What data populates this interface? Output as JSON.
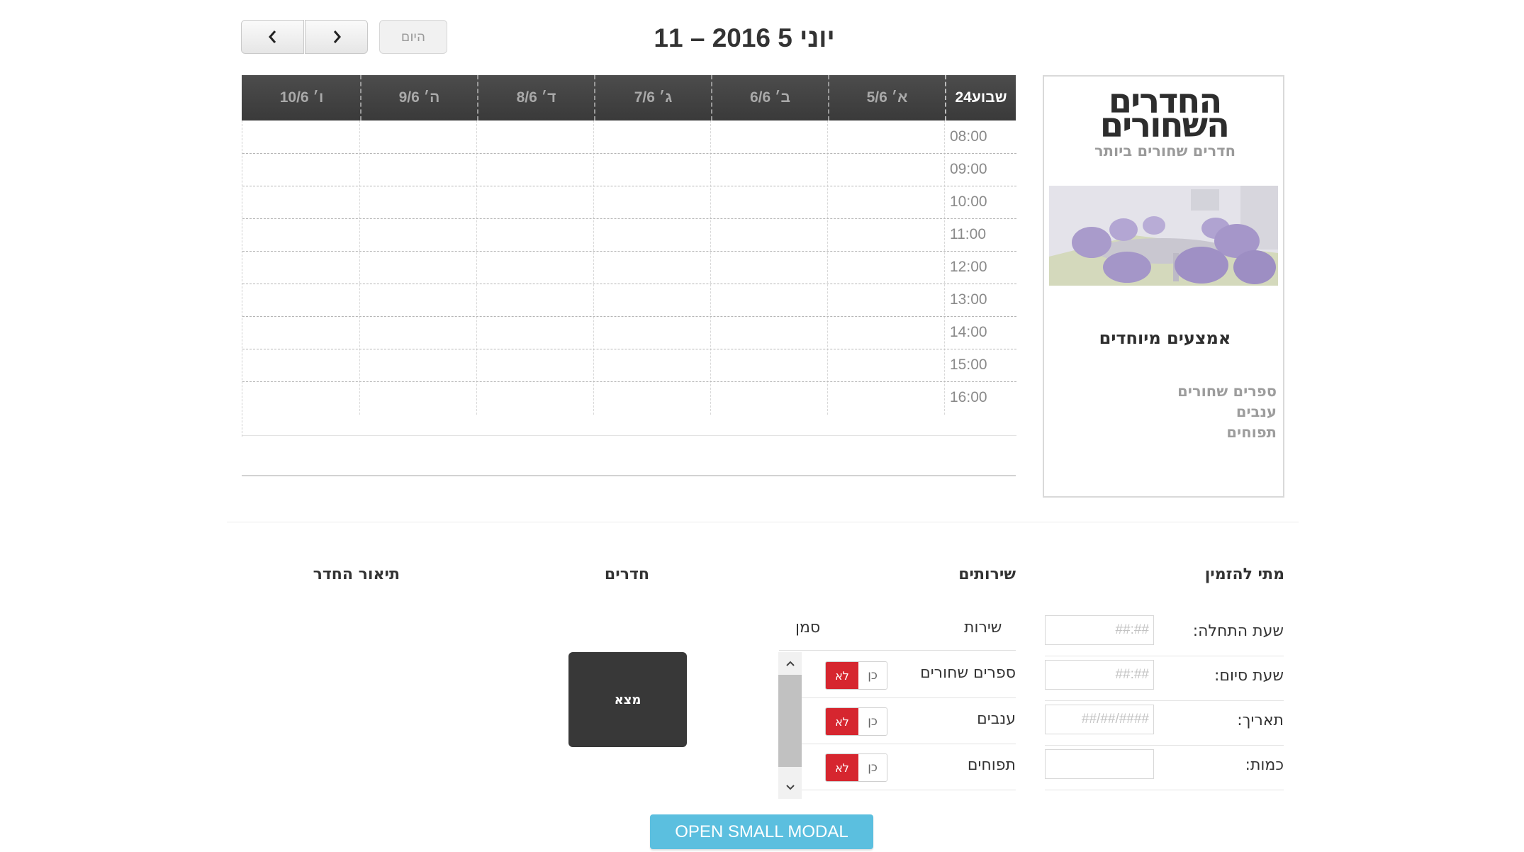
{
  "toolbar": {
    "title": "יוני 5 2016 – 11",
    "today_label": "היום"
  },
  "calendar": {
    "week_label": "שבוע24",
    "days": [
      "א׳ 5/6",
      "ב׳ 6/6",
      "ג׳ 7/6",
      "ד׳ 8/6",
      "ה׳ 9/6",
      "ו׳ 10/6"
    ],
    "times": [
      "08:00",
      "09:00",
      "10:00",
      "11:00",
      "12:00",
      "13:00",
      "14:00",
      "15:00",
      "16:00"
    ]
  },
  "side_card": {
    "logo_line1": "החדרים",
    "logo_line2": "השחורים",
    "tagline": "חדרים שחורים ביותר",
    "features_title": "אמצעים מיוחדים",
    "features": [
      "ספרים שחורים",
      "ענבים",
      "תפוחים"
    ]
  },
  "sections": {
    "when": "מתי להזמין",
    "services": "שירותים",
    "rooms": "חדרים",
    "room_description": "תיאור החדר"
  },
  "when_form": {
    "start_label": "שעת התחלה:",
    "start_placeholder": "##:##",
    "end_label": "שעת סיום:",
    "end_placeholder": "##:##",
    "date_label": "תאריך:",
    "date_placeholder": "##/##/####",
    "quantity_label": "כמות:",
    "quantity_value": ""
  },
  "services_table": {
    "col_service": "שירות",
    "col_mark": "סמן",
    "rows": [
      {
        "label": "ספרים שחורים",
        "yes": "כן",
        "no": "לא"
      },
      {
        "label": "ענבים",
        "yes": "כן",
        "no": "לא"
      },
      {
        "label": "תפוחים",
        "yes": "כן",
        "no": "לא"
      }
    ]
  },
  "find_label": "מצא",
  "modal_label": "OPEN SMALL MODAL",
  "colors": {
    "toggle_no_active": "#d6262f",
    "modal_button": "#5bbfdf",
    "find_button": "#383838",
    "calendar_header": "#404040"
  }
}
